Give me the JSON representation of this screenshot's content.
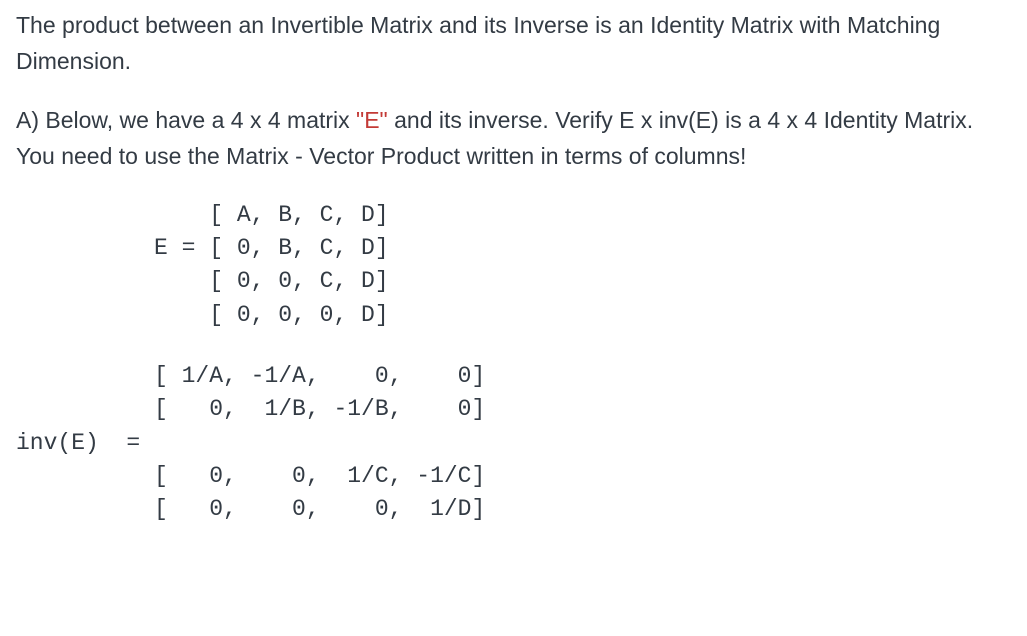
{
  "intro_text": "The product between an Invertible Matrix and its Inverse is an Identity Matrix with Matching Dimension.",
  "partA": {
    "prefix": "A) Below, we have a 4 x 4 matrix ",
    "quoted": "\"E\"",
    "suffix": " and its inverse. Verify E x inv(E) is  a 4 x 4 Identity Matrix. You need to use the Matrix - Vector Product written in terms of columns!"
  },
  "matrix_E_block": "              [ A, B, C, D]\n          E = [ 0, B, C, D]\n              [ 0, 0, C, D]\n              [ 0, 0, 0, D]",
  "matrix_invE_block": "          [ 1/A, -1/A,    0,    0]\n          [   0,  1/B, -1/B,    0]\ninv(E)  = \n          [   0,    0,  1/C, -1/C]\n          [   0,    0,    0,  1/D]",
  "chart_data": {
    "type": "table",
    "description": "Two 4x4 symbolic matrices: E (upper-triangular) and its inverse inv(E).",
    "matrices": [
      {
        "name": "E",
        "rows": [
          [
            "A",
            "B",
            "C",
            "D"
          ],
          [
            "0",
            "B",
            "C",
            "D"
          ],
          [
            "0",
            "0",
            "C",
            "D"
          ],
          [
            "0",
            "0",
            "0",
            "D"
          ]
        ]
      },
      {
        "name": "inv(E)",
        "rows": [
          [
            "1/A",
            "-1/A",
            "0",
            "0"
          ],
          [
            "0",
            "1/B",
            "-1/B",
            "0"
          ],
          [
            "0",
            "0",
            "1/C",
            "-1/C"
          ],
          [
            "0",
            "0",
            "0",
            "1/D"
          ]
        ]
      }
    ]
  }
}
